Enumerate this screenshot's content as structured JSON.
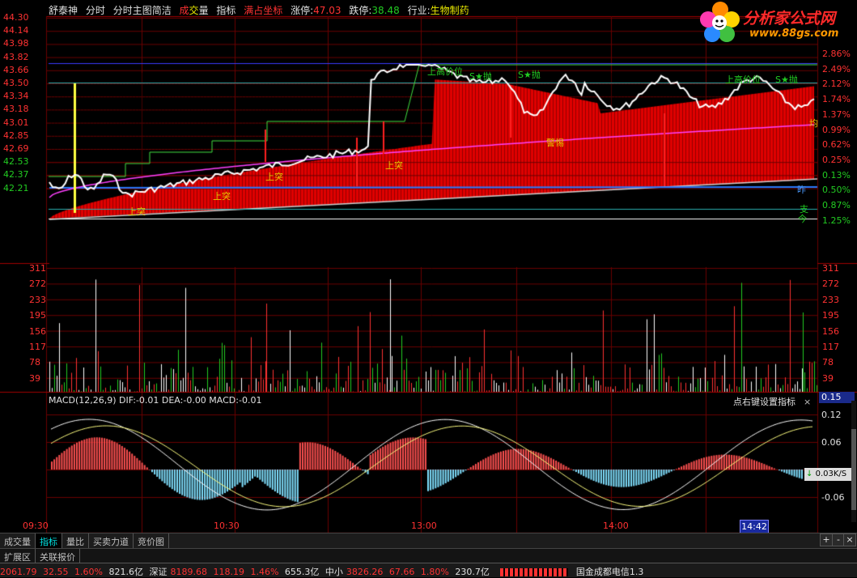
{
  "title_bar": {
    "stock_name": "舒泰神",
    "menu_fenshi": "分时",
    "menu_main": "分时主图简洁",
    "menu_volume_a": "成",
    "menu_volume_b": "交",
    "menu_volume_c": "量",
    "menu_indicator": "指标",
    "menu_fullscreen": "满占坐标",
    "limit_up_label": "涨停:",
    "limit_up_value": "47.03",
    "limit_down_label": "跌停:",
    "limit_down_value": "38.48",
    "industry_label": "行业:",
    "industry_value": "生物制药"
  },
  "logo": {
    "name": "分析家公式网",
    "url": "www.88gs.com"
  },
  "price_axis_left": [
    "44.30",
    "44.14",
    "43.98",
    "43.82",
    "43.66",
    "43.50",
    "43.34",
    "43.18",
    "43.01",
    "42.85",
    "42.69",
    "42.53",
    "42.37",
    "42.21"
  ],
  "pct_axis_right": [
    "2.86%",
    "2.49%",
    "2.12%",
    "1.74%",
    "1.37%",
    "0.99%",
    "0.62%",
    "0.25%",
    "0.13%",
    "0.50%",
    "0.87%",
    "1.25%"
  ],
  "volume_axis_left": [
    "311",
    "272",
    "233",
    "195",
    "156",
    "117",
    "78",
    "39"
  ],
  "volume_axis_right": [
    "311",
    "272",
    "233",
    "195",
    "156",
    "117",
    "78",
    "39"
  ],
  "macd": {
    "header": "MACD(12,26,9)  DIF:-0.01  DEA:-0.00  MACD:-0.01",
    "hint": "点右键设置指标",
    "close": "×",
    "current": "0.15",
    "axis": [
      "0.12",
      "0.06",
      "-0.06"
    ]
  },
  "time_axis": [
    "09:30",
    "10:30",
    "13:00",
    "14:00"
  ],
  "cursor_time": "14:42",
  "speed_readout": "0.03K/S",
  "chart_labels": {
    "breakout": "上突",
    "warning": "警惕",
    "avg_label": "均",
    "yesterday_label": "昨",
    "support": "支",
    "today": "今",
    "sell_star": "S★抛",
    "high_level": "上高价位"
  },
  "tabs": [
    "成交量",
    "指标",
    "量比",
    "买卖力道",
    "竞价图"
  ],
  "tabs_active_index": 1,
  "tabs2": [
    "扩展区",
    "关联报价"
  ],
  "plus": "+",
  "minus": "-",
  "close_x": "×",
  "status_bar": {
    "sh_index": "2061.79",
    "sh_change": "32.55",
    "sh_pct": "1.60%",
    "sh_amount": "821.6亿",
    "sz_label": "深证",
    "sz_index": "8189.68",
    "sz_change": "118.19",
    "sz_pct": "1.46%",
    "sz_amount": "655.3亿",
    "zx_label": "中小",
    "zx_index": "3826.26",
    "zx_change": "67.66",
    "zx_pct": "1.80%",
    "zx_amount": "230.7亿",
    "broker": "国金成都电信1.3"
  },
  "colors": {
    "up": "#ff3232",
    "down": "#22cc22",
    "grid": "#8b0000",
    "price_line": "#ffffff",
    "avg_line": "#ff40ff",
    "macd_dea": "#ffff80",
    "macd_neg": "#80e0ff"
  }
}
